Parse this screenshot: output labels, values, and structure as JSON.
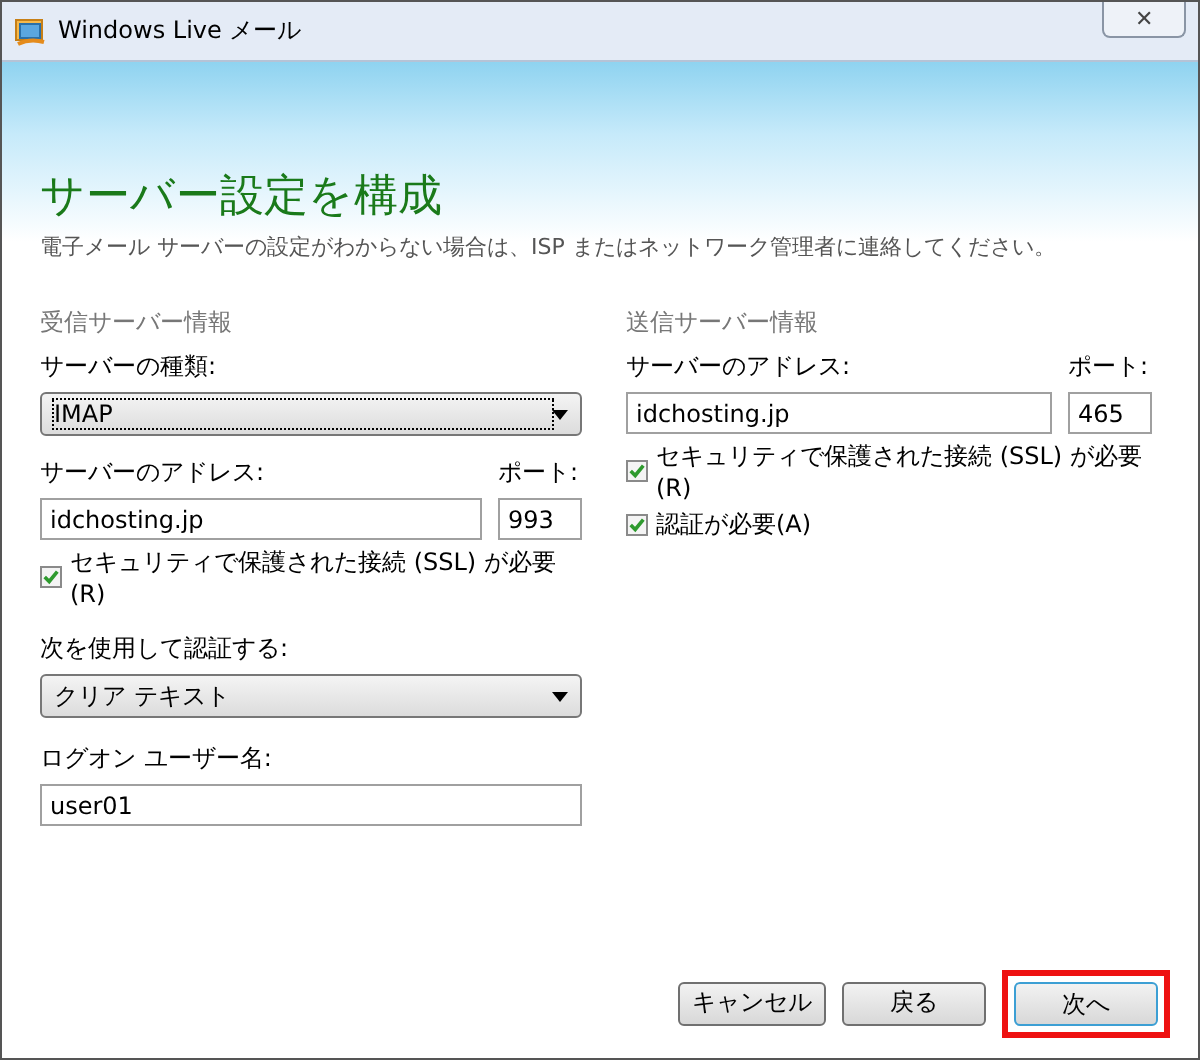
{
  "window": {
    "title": "Windows Live メール",
    "close": "✕"
  },
  "heading": "サーバー設定を構成",
  "subtitle": "電子メール サーバーの設定がわからない場合は、ISP またはネットワーク管理者に連絡してください。",
  "incoming": {
    "section": "受信サーバー情報",
    "type_label": "サーバーの種類:",
    "type_value": "IMAP",
    "address_label": "サーバーのアドレス:",
    "address": "idchosting.jp",
    "port_label": "ポート:",
    "port": "993",
    "ssl": {
      "label": "セキュリティで保護された接続 (SSL) が必要(R)",
      "checked": true
    },
    "auth_label": "次を使用して認証する:",
    "auth_value": "クリア テキスト",
    "user_label": "ログオン ユーザー名:",
    "user": "user01"
  },
  "outgoing": {
    "section": "送信サーバー情報",
    "address_label": "サーバーのアドレス:",
    "address": "idchosting.jp",
    "port_label": "ポート:",
    "port": "465",
    "checks": [
      {
        "label": "セキュリティで保護された接続 (SSL) が必要(R)",
        "checked": true
      },
      {
        "label": "認証が必要(A)",
        "checked": true
      }
    ]
  },
  "buttons": [
    {
      "label": "キャンセル",
      "highlighted": false
    },
    {
      "label": "戻る",
      "highlighted": false
    },
    {
      "label": "次へ",
      "highlighted": true
    }
  ]
}
